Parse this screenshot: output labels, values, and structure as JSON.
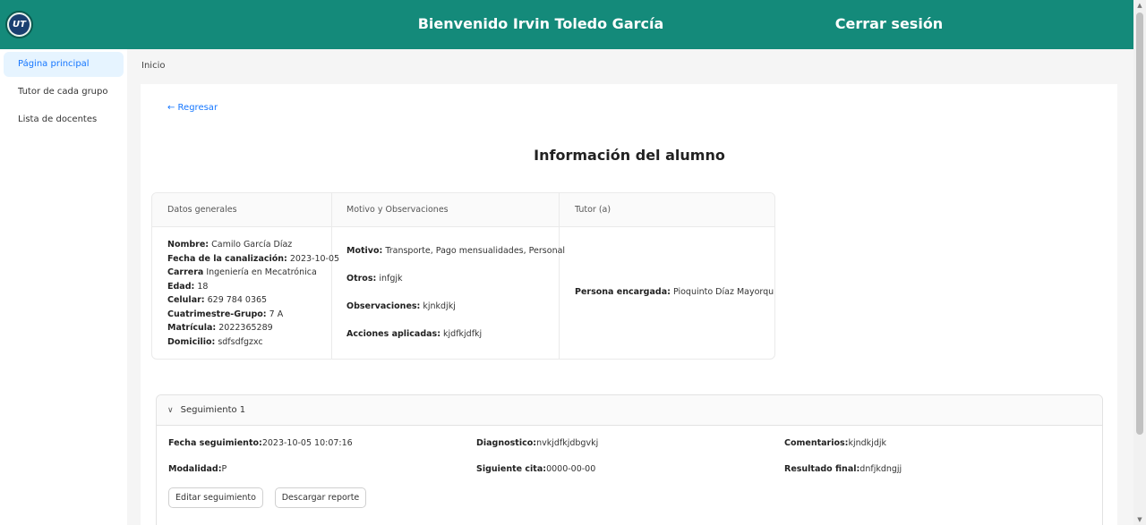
{
  "header": {
    "logo_text": "UT",
    "welcome": "Bienvenido Irvin Toledo García",
    "logout_label": "Cerrar sesión",
    "color": "#148a7a"
  },
  "sidebar": {
    "items": [
      {
        "label": "Página principal",
        "active": true
      },
      {
        "label": "Tutor de cada grupo",
        "active": false
      },
      {
        "label": "Lista de docentes",
        "active": false
      }
    ]
  },
  "breadcrumb": "Inicio",
  "back_label": "← Regresar",
  "page_title": "Información del alumno",
  "table": {
    "headers": [
      "Datos generales",
      "Motivo y Observaciones",
      "Tutor (a)"
    ],
    "general": [
      {
        "label": "Nombre:",
        "value": " Camilo García Díaz"
      },
      {
        "label": "Fecha de la canalización:",
        "value": " 2023-10-05"
      },
      {
        "label": "Carrera",
        "value": " Ingeniería en Mecatrónica"
      },
      {
        "label": "Edad:",
        "value": " 18"
      },
      {
        "label": "Celular:",
        "value": " 629 784 0365"
      },
      {
        "label": "Cuatrimestre-Grupo:",
        "value": " 7 A"
      },
      {
        "label": "Matrícula:",
        "value": " 2022365289"
      },
      {
        "label": "Domicilio:",
        "value": " sdfsdfgzxc"
      }
    ],
    "motivo": [
      {
        "label": "Motivo:",
        "value": " Transporte, Pago mensualidades, Personal"
      },
      {
        "label": "Otros:",
        "value": " infgjk"
      },
      {
        "label": "Observaciones:",
        "value": " kjnkdjkj"
      },
      {
        "label": "Acciones aplicadas:",
        "value": " kjdfkjdfkj"
      }
    ],
    "tutor": {
      "label": "Persona encargada:",
      "value": " Pioquinto Díaz Mayorquín"
    }
  },
  "seguimiento": {
    "title": "Seguimiento 1",
    "fecha": {
      "label": "Fecha seguimiento:",
      "value": "2023-10-05 10:07:16"
    },
    "diagnostico": {
      "label": "Diagnostico:",
      "value": "nvkjdfkjdbgvkj"
    },
    "comentarios": {
      "label": "Comentarios:",
      "value": "kjndkjdjk"
    },
    "modalidad": {
      "label": "Modalidad:",
      "value": "P"
    },
    "siguiente": {
      "label": "Siguiente cita:",
      "value": "0000-00-00"
    },
    "resultado": {
      "label": "Resultado final:",
      "value": "dnfjkdngjj"
    },
    "edit_label": "Editar seguimiento",
    "download_label": "Descargar reporte"
  }
}
